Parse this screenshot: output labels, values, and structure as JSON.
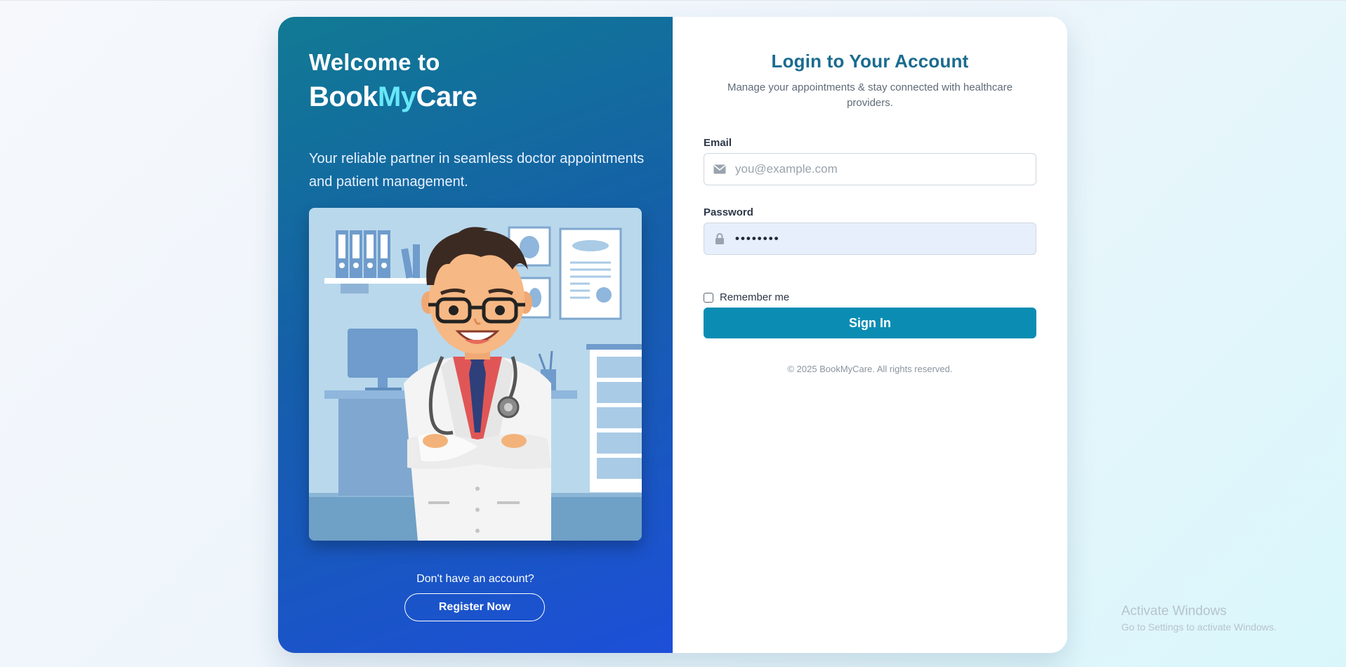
{
  "welcome": {
    "line1": "Welcome to",
    "brand_part1": "Book",
    "brand_part2": "My",
    "brand_part3": "Care",
    "tagline": "Your reliable partner in seamless doctor appointments and patient management."
  },
  "register": {
    "prompt": "Don't have an account?",
    "button_label": "Register Now"
  },
  "login": {
    "title": "Login to Your Account",
    "subtitle": "Manage your appointments & stay connected with healthcare providers.",
    "email_label": "Email",
    "email_placeholder": "you@example.com",
    "email_icon": "envelope-icon",
    "password_label": "Password",
    "password_value": "password",
    "password_icon": "lock-icon",
    "remember_label": "Remember me",
    "remember_checked": false,
    "signin_label": "Sign In",
    "copyright": "© 2025 BookMyCare. All rights reserved."
  },
  "illustration": {
    "icon": "doctor-illustration"
  },
  "watermark": {
    "line1": "Activate Windows",
    "line2": "Go to Settings to activate Windows."
  },
  "colors": {
    "accent": "#0b8db3",
    "title": "#1a6b8f",
    "brand_highlight": "#67e8f9",
    "panel_gradient_start": "#117a94",
    "panel_gradient_end": "#1d4fd8"
  }
}
